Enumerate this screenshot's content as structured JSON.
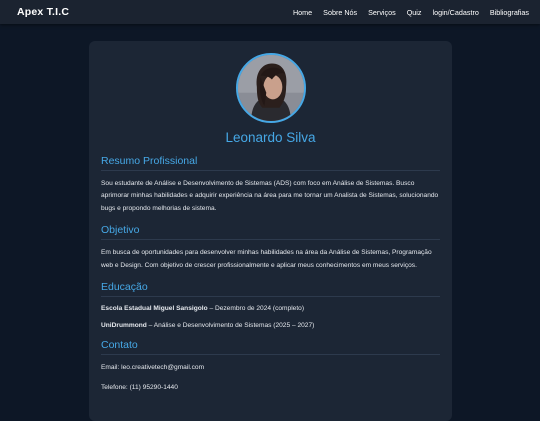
{
  "nav": {
    "brand": "Apex T.I.C",
    "links": [
      "Home",
      "Sobre Nós",
      "Serviços",
      "Quiz",
      "login/Cadastro",
      "Bibliografias"
    ]
  },
  "profile": {
    "name": "Leonardo Silva",
    "avatar": "profile-photo"
  },
  "sections": {
    "resumo": {
      "title": "Resumo Profissional",
      "text": "Sou estudante de Análise e Desenvolvimento de Sistemas (ADS) com foco em Análise de Sistemas. Busco aprimorar minhas habilidades e adquirir experiência na área para me tornar um Analista de Sistemas, solucionando bugs e propondo melhorias de sistema."
    },
    "objetivo": {
      "title": "Objetivo",
      "text": "Em busca de oportunidades para desenvolver minhas habilidades na área da Análise de Sistemas, Programação web e Design. Com objetivo de crescer profissionalmente e aplicar meus conhecimentos em meus serviços."
    },
    "educacao": {
      "title": "Educação",
      "items": [
        {
          "school": "Escola Estadual Miguel Sansigolo",
          "detail": " – Dezembro de 2024 (completo)"
        },
        {
          "school": "UniDrummond",
          "detail": " – Análise e Desenvolvimento de Sistemas (2025 – 2027)"
        }
      ]
    },
    "contato": {
      "title": "Contato",
      "email": "Email: leo.creativetech@gmail.com",
      "phone": "Telefone: (11) 95290-1440"
    }
  },
  "colors": {
    "background": "#0d1726",
    "navbar": "#1b2330",
    "card": "#1c2635",
    "accent": "#46a8e6"
  }
}
